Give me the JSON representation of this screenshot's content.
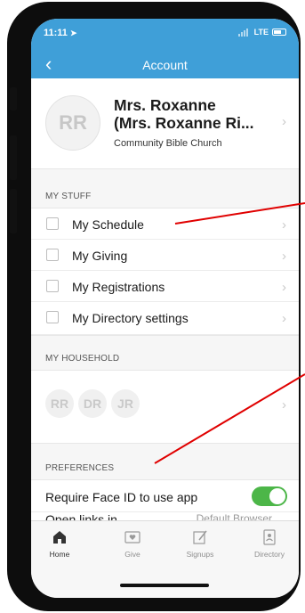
{
  "status": {
    "time": "11:11",
    "network": "LTE"
  },
  "nav": {
    "title": "Account",
    "back_glyph": "‹"
  },
  "profile": {
    "initials": "RR",
    "name_line1": "Mrs. Roxanne",
    "name_line2": "(Mrs. Roxanne Ri...",
    "organization": "Community Bible Church"
  },
  "sections": {
    "my_stuff": "MY STUFF",
    "my_household": "MY HOUSEHOLD",
    "preferences": "PREFERENCES"
  },
  "my_stuff_items": [
    {
      "label": "My Schedule",
      "icon": "list-icon"
    },
    {
      "label": "My Giving",
      "icon": "giving-icon"
    },
    {
      "label": "My Registrations",
      "icon": "calendar-star-icon"
    },
    {
      "label": "My Directory settings",
      "icon": "contact-card-icon"
    }
  ],
  "household": {
    "members": [
      "RR",
      "DR",
      "JR"
    ]
  },
  "preferences": {
    "face_id_label": "Require Face ID to use app",
    "face_id_enabled": true,
    "open_links_label": "Open links in",
    "open_links_value": "Default Browser"
  },
  "tabs": [
    {
      "label": "Home",
      "icon": "home-icon",
      "active": true
    },
    {
      "label": "Give",
      "icon": "give-icon",
      "active": false
    },
    {
      "label": "Signups",
      "icon": "signups-icon",
      "active": false
    },
    {
      "label": "Directory",
      "icon": "directory-icon",
      "active": false
    }
  ],
  "colors": {
    "header": "#3f9fd8",
    "toggle_on": "#4cb648",
    "annotation": "#e00000"
  }
}
